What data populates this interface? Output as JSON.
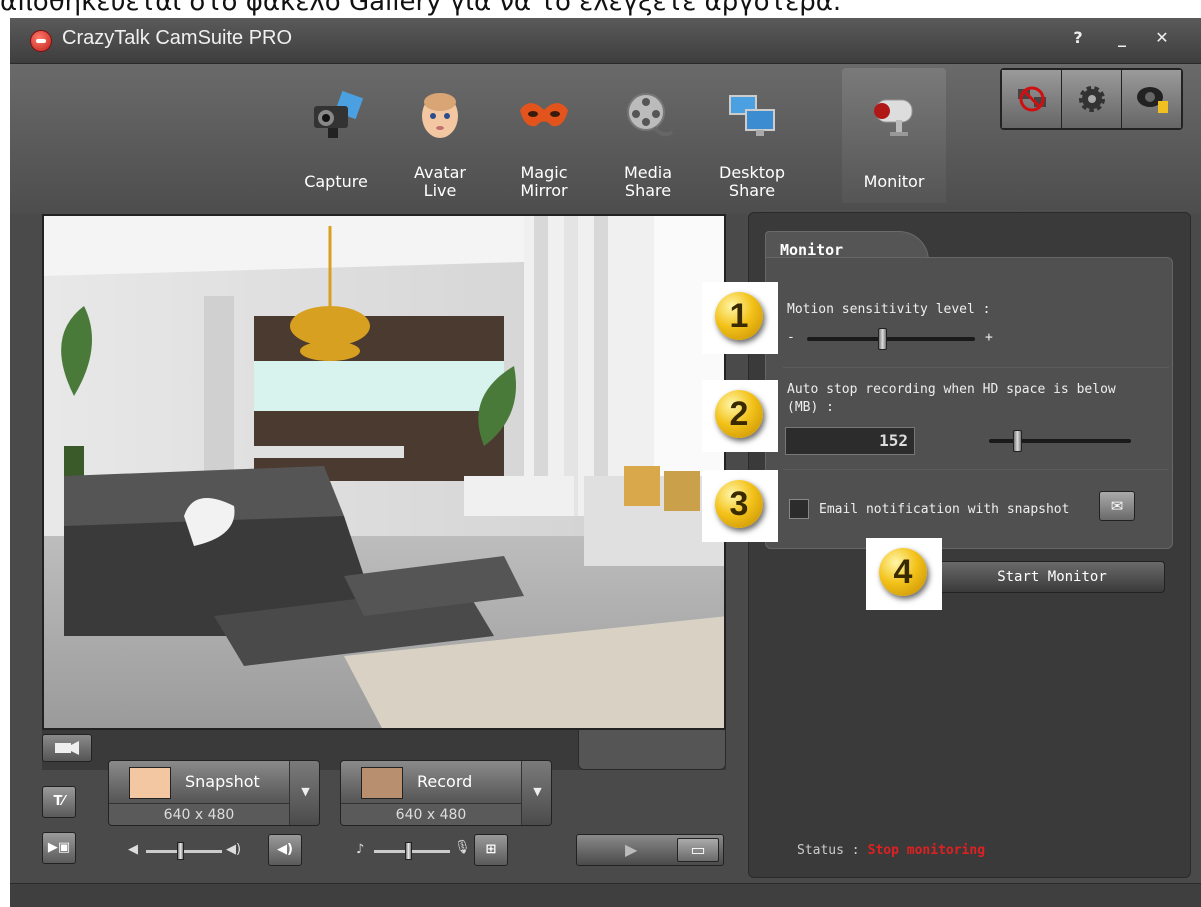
{
  "top_caption": "αποθηκεύεται στο φάκελο Gallery για να το ελέγξετε αργότερα.",
  "app": {
    "title": "CrazyTalk CamSuite PRO",
    "help_label": "?",
    "minimize_label": "_",
    "close_label": "✕"
  },
  "tabs": [
    {
      "label": "Capture",
      "icon": "camera-icon"
    },
    {
      "label": "Avatar\nLive",
      "icon": "baby-face-icon"
    },
    {
      "label": "Magic\nMirror",
      "icon": "mask-icon"
    },
    {
      "label": "Media\nShare",
      "icon": "film-reel-icon"
    },
    {
      "label": "Desktop\nShare",
      "icon": "monitors-icon"
    },
    {
      "label": "Monitor",
      "icon": "security-camera-icon",
      "active": true
    }
  ],
  "right_tools": [
    "no-network-icon",
    "gear-icon",
    "webcam-icon"
  ],
  "panel": {
    "tab_label": "Monitor",
    "motion_label": "Motion sensitivity level :",
    "motion_minus": "-",
    "motion_plus": "+",
    "motion_level": 0.45,
    "autostop_label": "Auto stop recording when HD space is below (MB) :",
    "autostop_value": "152",
    "autostop_level": 0.2,
    "email_label": "Email notification with snapshot",
    "email_checked": false,
    "start_button": "Start Monitor",
    "status_label": "Status :",
    "status_value": "Stop monitoring",
    "badges": [
      "1",
      "2",
      "3",
      "4"
    ]
  },
  "controls": {
    "snapshot_label": "Snapshot",
    "snapshot_res": "640 x 480",
    "record_label": "Record",
    "record_res": "640 x 480",
    "volume_level": 0.45,
    "mic_level": 0.45
  },
  "colors": {
    "status_red": "#e02020",
    "badge_gold": "#f3c21a"
  }
}
